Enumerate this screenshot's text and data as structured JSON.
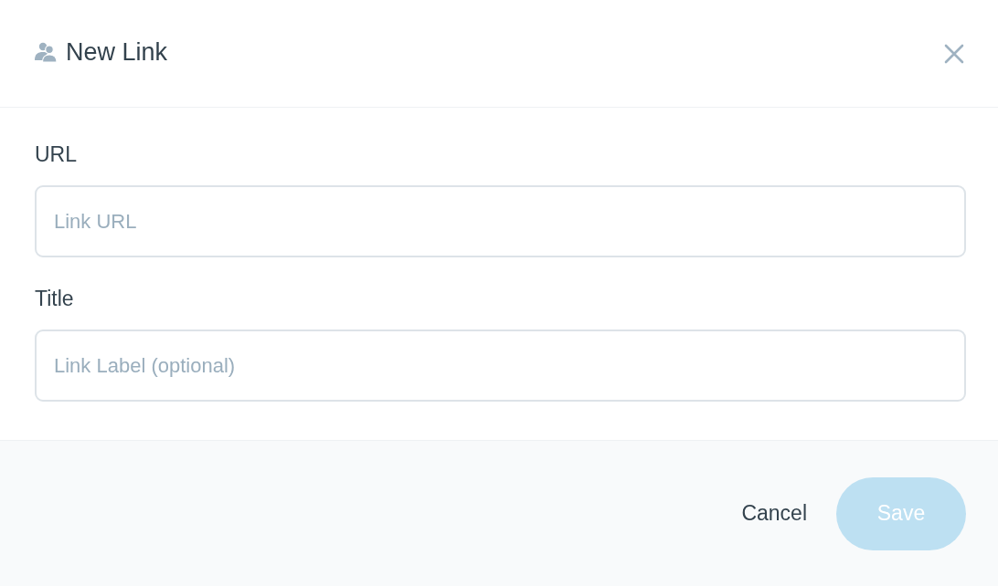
{
  "dialog": {
    "title": "New Link",
    "fields": [
      {
        "label": "URL",
        "placeholder": "Link URL"
      },
      {
        "label": "Title",
        "placeholder": "Link Label (optional)"
      }
    ],
    "buttons": [
      {
        "kind": "plain",
        "label": "Cancel",
        "disabled": false
      },
      {
        "kind": "primary",
        "label": "Save",
        "disabled": true
      }
    ]
  }
}
